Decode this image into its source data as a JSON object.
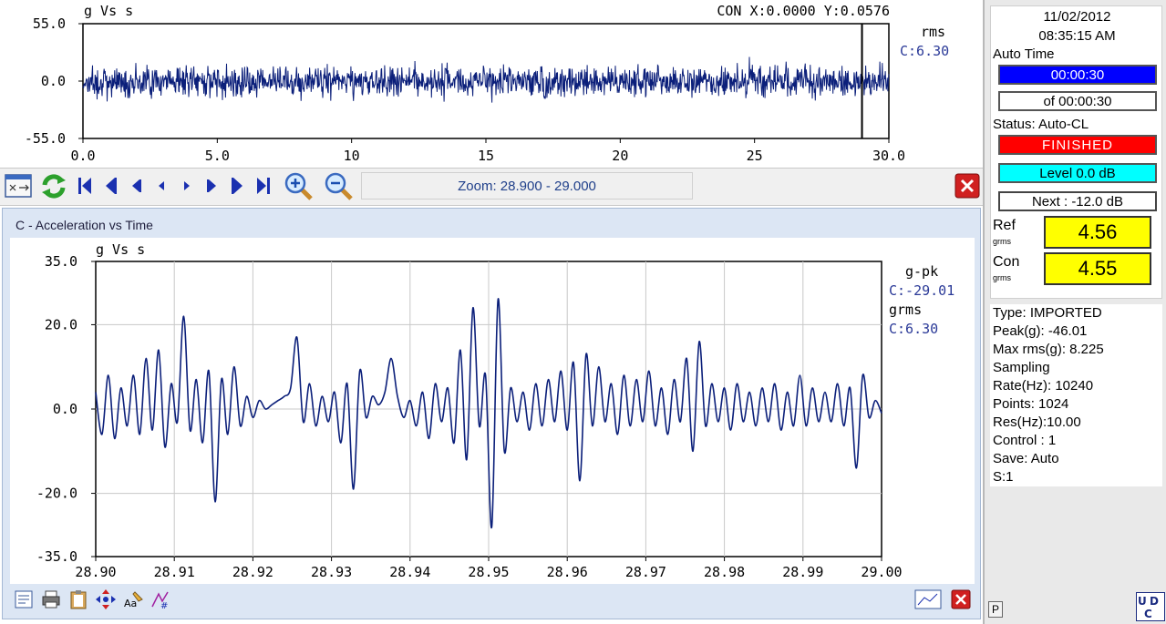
{
  "overview": {
    "title": "g Vs s",
    "cursor_readout": "CON X:0.0000 Y:0.0576",
    "legend_metric": "rms",
    "legend_value": "C:6.30",
    "line_color": "#0b1f7a"
  },
  "toolbar": {
    "zoom_text": "Zoom: 28.900 - 29.000"
  },
  "panel": {
    "title": "C - Acceleration  vs  Time"
  },
  "detail": {
    "title": "g Vs s",
    "legend_pk": "g-pk",
    "legend_pk_value": "C:-29.01",
    "legend_rms": "grms",
    "legend_rms_value": "C:6.30",
    "line_color": "#0b1f7a"
  },
  "status": {
    "date": "11/02/2012",
    "time": "08:35:15 AM",
    "auto_time_label": "Auto Time",
    "elapsed": "00:00:30",
    "total": "of 00:00:30",
    "status_label": "Status: Auto-CL",
    "status_value": "FINISHED",
    "level": "Level   0.0 dB",
    "next": "Next  : -12.0 dB",
    "ref_label": "Ref",
    "ref_unit": "grms",
    "ref_value": "4.56",
    "con_label": "Con",
    "con_unit": "grms",
    "con_value": "4.55",
    "colors": {
      "elapsed": "#0000ff",
      "finished": "#ff0000",
      "level": "#00ffff",
      "value": "#ffff00"
    }
  },
  "info": {
    "lines": [
      "Type: IMPORTED",
      "Peak(g): -46.01",
      "Max rms(g): 8.225",
      "Sampling",
      "Rate(Hz):  10240",
      "Points: 1024",
      "Res(Hz):10.00",
      "Control : 1",
      "Save: Auto",
      "S:1"
    ]
  },
  "footer": {
    "p_button": "P",
    "logo_text": "UDC"
  },
  "chart_data": [
    {
      "type": "line",
      "title": "g Vs s",
      "xlim": [
        0,
        30
      ],
      "ylim": [
        -55,
        55
      ],
      "x_ticks": [
        "0.0",
        "5.0",
        "10",
        "15",
        "20",
        "25",
        "30.0"
      ],
      "y_ticks": [
        "55.0",
        "0.0",
        "-55.0"
      ],
      "series": [
        {
          "name": "C",
          "amplitude_rms": 6.3,
          "cursor_x": 29.0
        }
      ]
    },
    {
      "type": "line",
      "title": "g Vs s",
      "xlim": [
        28.9,
        29.0
      ],
      "ylim": [
        -35,
        35
      ],
      "x_ticks": [
        "28.90",
        "28.91",
        "28.92",
        "28.93",
        "28.94",
        "28.95",
        "28.96",
        "28.97",
        "28.98",
        "28.99",
        "29.00"
      ],
      "y_ticks": [
        "35.0",
        "20.0",
        "0.0",
        "-20.0",
        "-35.0"
      ],
      "series": [
        {
          "name": "C",
          "x": [
            28.9,
            28.9008,
            28.9016,
            28.9024,
            28.9032,
            28.904,
            28.9048,
            28.9056,
            28.9064,
            28.9072,
            28.908,
            28.9088,
            28.9096,
            28.9104,
            28.9112,
            28.912,
            28.9128,
            28.9136,
            28.9144,
            28.9152,
            28.916,
            28.9168,
            28.9176,
            28.9184,
            28.9192,
            28.92,
            28.9208,
            28.9216,
            28.9224,
            28.9232,
            28.924,
            28.9248,
            28.9256,
            28.9264,
            28.9272,
            28.928,
            28.9288,
            28.9296,
            28.9304,
            28.9312,
            28.932,
            28.9328,
            28.9336,
            28.9344,
            28.9352,
            28.936,
            28.9368,
            28.9376,
            28.9384,
            28.9392,
            28.94,
            28.9408,
            28.9416,
            28.9424,
            28.9432,
            28.944,
            28.9448,
            28.9456,
            28.9464,
            28.9472,
            28.948,
            28.9488,
            28.9496,
            28.9504,
            28.9512,
            28.952,
            28.9528,
            28.9536,
            28.9544,
            28.9552,
            28.956,
            28.9568,
            28.9576,
            28.9584,
            28.9592,
            28.96,
            28.9608,
            28.9616,
            28.9624,
            28.9632,
            28.964,
            28.9648,
            28.9656,
            28.9664,
            28.9672,
            28.968,
            28.9688,
            28.9696,
            28.9704,
            28.9712,
            28.972,
            28.9728,
            28.9736,
            28.9744,
            28.9752,
            28.976,
            28.9768,
            28.9776,
            28.9784,
            28.9792,
            28.98,
            28.9808,
            28.9816,
            28.9824,
            28.9832,
            28.984,
            28.9848,
            28.9856,
            28.9864,
            28.9872,
            28.988,
            28.9888,
            28.9896,
            28.9904,
            28.9912,
            28.992,
            28.9928,
            28.9936,
            28.9944,
            28.9952,
            28.996,
            28.9968,
            28.9976,
            28.9984,
            28.9992,
            29.0
          ],
          "y": [
            4,
            -6,
            8,
            -7,
            5,
            -4,
            8,
            -6,
            12,
            -5,
            14,
            -9,
            6,
            -3,
            22,
            -5,
            7,
            -8,
            9,
            -22,
            7,
            -6,
            10,
            -4,
            3,
            -2,
            2,
            0,
            1,
            2,
            3,
            5,
            17,
            -3,
            6,
            -4,
            3,
            -3,
            4,
            -8,
            6,
            -19,
            9,
            -2,
            3,
            1,
            4,
            12,
            3,
            -2,
            2,
            -4,
            4,
            -7,
            6,
            -3,
            5,
            -8,
            14,
            -12,
            24,
            -4,
            8,
            -28,
            26,
            -10,
            5,
            -3,
            4,
            -5,
            6,
            -4,
            7,
            -3,
            9,
            -5,
            11,
            -17,
            13,
            -4,
            10,
            -3,
            6,
            -6,
            8,
            -4,
            7,
            -3,
            9,
            -4,
            5,
            -6,
            7,
            -3,
            12,
            -10,
            16,
            -4,
            6,
            -3,
            5,
            -5,
            6,
            -3,
            4,
            -4,
            5,
            -3,
            6,
            -5,
            4,
            -4,
            8,
            -4,
            5,
            -3,
            4,
            -3,
            6,
            -4,
            5,
            -14,
            8,
            -2,
            2,
            -1
          ]
        }
      ]
    }
  ]
}
